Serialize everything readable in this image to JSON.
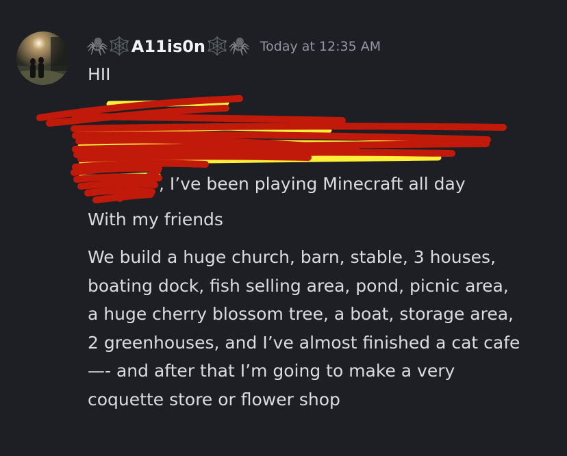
{
  "message": {
    "author": {
      "name": "A11is0n",
      "decor_left": "🕷️🕸️",
      "decor_right": "🕸️🕷️"
    },
    "timestamp": "Today at 12:35 AM",
    "lines": {
      "greeting": "HII",
      "partial": ", I’ve been playing Minecraft all day",
      "friends": "With my friends",
      "p1": "We build a huge church, barn, stable, 3 houses,",
      "p2": "boating dock, fish selling area, pond, picnic area,",
      "p3": "a huge cherry blossom tree, a boat, storage area,",
      "p4": "2 greenhouses, and I’ve almost finished a cat cafe",
      "p5": "—- and after that I’m going to make a very",
      "p6": "coquette store or flower shop"
    }
  },
  "colors": {
    "background": "#1e1f24",
    "scribble_red": "#c21a0a",
    "highlight_yellow": "#ffef3a"
  }
}
